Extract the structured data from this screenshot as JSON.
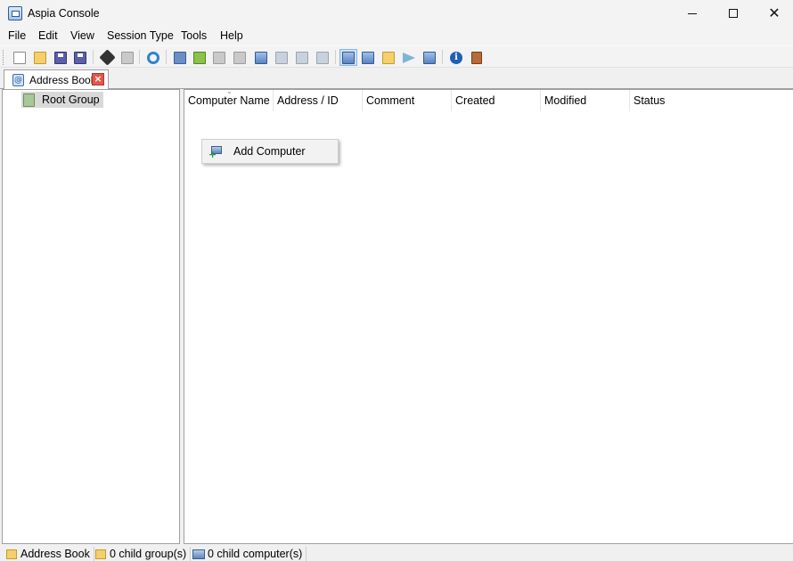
{
  "window": {
    "title": "Aspia Console",
    "controls": {
      "minimize": "—",
      "maximize": "☐",
      "close": "✕"
    }
  },
  "menu": {
    "items": [
      {
        "label": "File"
      },
      {
        "label": "Edit"
      },
      {
        "label": "View"
      },
      {
        "label": "Session Type"
      },
      {
        "label": "Tools"
      },
      {
        "label": "Help"
      }
    ]
  },
  "toolbar": {
    "buttons": [
      {
        "icon": "new-file-icon"
      },
      {
        "icon": "open-file-icon"
      },
      {
        "icon": "save-icon"
      },
      {
        "icon": "save-all-icon"
      },
      {
        "icon": "connect-plug-icon"
      },
      {
        "icon": "disconnect-icon"
      },
      {
        "icon": "refresh-icon"
      },
      {
        "icon": "add-group-icon"
      },
      {
        "icon": "edit-group-icon"
      },
      {
        "icon": "delete-group-icon"
      },
      {
        "icon": "group-properties-icon"
      },
      {
        "icon": "add-computer-icon"
      },
      {
        "icon": "edit-computer-icon"
      },
      {
        "icon": "copy-computer-icon"
      },
      {
        "icon": "delete-computer-icon"
      },
      {
        "icon": "desktop-manage-icon",
        "active": true
      },
      {
        "icon": "desktop-view-icon"
      },
      {
        "icon": "file-transfer-icon"
      },
      {
        "icon": "text-chat-icon"
      },
      {
        "icon": "system-info-icon"
      },
      {
        "icon": "about-info-icon"
      },
      {
        "icon": "exit-door-icon"
      }
    ]
  },
  "tabs": [
    {
      "label": "Address Book",
      "close": "×"
    }
  ],
  "tree": {
    "root": {
      "label": "Root Group"
    }
  },
  "list": {
    "columns": [
      {
        "label": "Computer Name"
      },
      {
        "label": "Address / ID"
      },
      {
        "label": "Comment"
      },
      {
        "label": "Created"
      },
      {
        "label": "Modified"
      },
      {
        "label": "Status"
      }
    ],
    "sort_indicator": "⌄"
  },
  "context_menu": {
    "items": [
      {
        "label": "Add Computer",
        "icon": "add-computer-icon"
      }
    ]
  },
  "status_bar": {
    "address_book": "Address Book",
    "child_groups": "0 child group(s)",
    "child_computers": "0 child computer(s)"
  }
}
